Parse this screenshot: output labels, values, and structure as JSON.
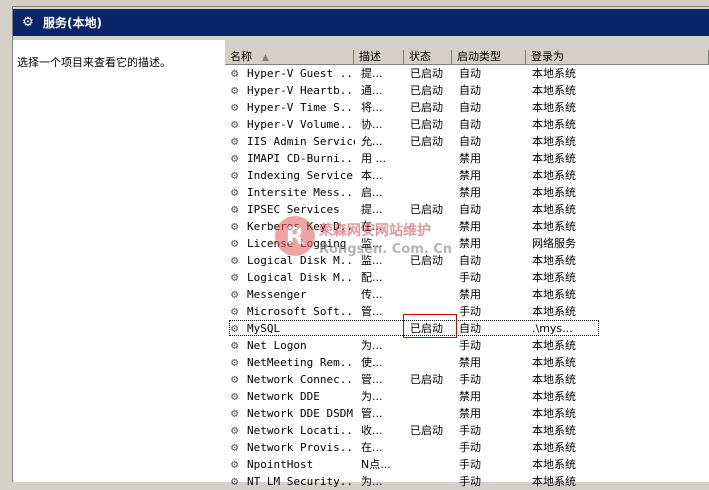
{
  "window": {
    "title": "服务(本地)"
  },
  "description_pane": {
    "text": "选择一个项目来查看它的描述。"
  },
  "columns": {
    "name": "名称",
    "description": "描述",
    "status": "状态",
    "startup_type": "启动类型",
    "logon_as": "登录为"
  },
  "services": [
    {
      "name": "Hyper-V Guest ...",
      "desc": "提...",
      "status": "已启动",
      "start": "自动",
      "logon": "本地系统"
    },
    {
      "name": "Hyper-V Heartb...",
      "desc": "通...",
      "status": "已启动",
      "start": "自动",
      "logon": "本地系统"
    },
    {
      "name": "Hyper-V Time S...",
      "desc": "将...",
      "status": "已启动",
      "start": "自动",
      "logon": "本地系统"
    },
    {
      "name": "Hyper-V Volume...",
      "desc": "协...",
      "status": "已启动",
      "start": "自动",
      "logon": "本地系统"
    },
    {
      "name": "IIS Admin Service",
      "desc": "允...",
      "status": "已启动",
      "start": "自动",
      "logon": "本地系统"
    },
    {
      "name": "IMAPI CD-Burni...",
      "desc": "用 ...",
      "status": "",
      "start": "禁用",
      "logon": "本地系统"
    },
    {
      "name": "Indexing Service",
      "desc": "本...",
      "status": "",
      "start": "禁用",
      "logon": "本地系统"
    },
    {
      "name": "Intersite Mess...",
      "desc": "启...",
      "status": "",
      "start": "禁用",
      "logon": "本地系统"
    },
    {
      "name": "IPSEC Services",
      "desc": "提...",
      "status": "已启动",
      "start": "自动",
      "logon": "本地系统"
    },
    {
      "name": "Kerberos Key D...",
      "desc": "在...",
      "status": "",
      "start": "禁用",
      "logon": "本地系统"
    },
    {
      "name": "License Logging",
      "desc": "监...",
      "status": "",
      "start": "禁用",
      "logon": "网络服务"
    },
    {
      "name": "Logical Disk M...",
      "desc": "监...",
      "status": "已启动",
      "start": "自动",
      "logon": "本地系统"
    },
    {
      "name": "Logical Disk M...",
      "desc": "配...",
      "status": "",
      "start": "手动",
      "logon": "本地系统"
    },
    {
      "name": "Messenger",
      "desc": "传...",
      "status": "",
      "start": "禁用",
      "logon": "本地系统"
    },
    {
      "name": "Microsoft Soft...",
      "desc": "管...",
      "status": "",
      "start": "手动",
      "logon": "本地系统"
    },
    {
      "name": "MySQL",
      "desc": "",
      "status": "已启动",
      "start": "自动",
      "logon": ".\\mys..."
    },
    {
      "name": "Net Logon",
      "desc": "为...",
      "status": "",
      "start": "手动",
      "logon": "本地系统"
    },
    {
      "name": "NetMeeting Rem...",
      "desc": "使...",
      "status": "",
      "start": "禁用",
      "logon": "本地系统"
    },
    {
      "name": "Network Connec...",
      "desc": "管...",
      "status": "已启动",
      "start": "手动",
      "logon": "本地系统"
    },
    {
      "name": "Network DDE",
      "desc": "为...",
      "status": "",
      "start": "禁用",
      "logon": "本地系统"
    },
    {
      "name": "Network DDE DSDM",
      "desc": "管...",
      "status": "",
      "start": "禁用",
      "logon": "本地系统"
    },
    {
      "name": "Network Locati...",
      "desc": "收...",
      "status": "已启动",
      "start": "手动",
      "logon": "本地系统"
    },
    {
      "name": "Network Provis...",
      "desc": "在...",
      "status": "",
      "start": "手动",
      "logon": "本地系统"
    },
    {
      "name": "NpointHost",
      "desc": "N点...",
      "status": "",
      "start": "手动",
      "logon": "本地系统"
    },
    {
      "name": "NT LM Security...",
      "desc": "为...",
      "status": "",
      "start": "手动",
      "logon": "本地系统"
    }
  ],
  "watermark": {
    "logo_letter": "R",
    "line1": "荣森网安网站维护",
    "line2": "Rongsen. Com. Cn"
  },
  "colors": {
    "titlebar": "#0a246a",
    "chrome": "#d4d0c8",
    "highlight": "#cc0000"
  },
  "icons": {
    "title": "gear-icon",
    "service": "gear-icon"
  }
}
